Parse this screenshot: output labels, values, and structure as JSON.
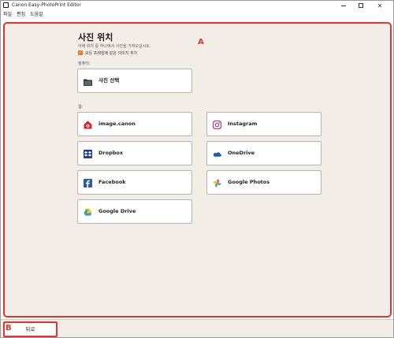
{
  "window": {
    "title": "Canon Easy-PhotoPrint Editor"
  },
  "menu": [
    "파일",
    "편집",
    "도움말"
  ],
  "callouts": {
    "a": "A",
    "b": "B"
  },
  "page": {
    "title": "사진 위치",
    "subtitle": "아래 위치 중 하나에서 사진을 가져오십시오.",
    "checkbox_label": "모든 프레임에 같은 이미지 추가",
    "checkbox_checked": true,
    "section_computer": "컴퓨터:",
    "section_web": "웹:"
  },
  "tiles": {
    "select_photo": {
      "label": "사진 선택",
      "icon": "folder-icon"
    },
    "image_canon": {
      "label": "image.canon",
      "icon": "image-canon-icon"
    },
    "instagram": {
      "label": "Instagram",
      "icon": "instagram-icon"
    },
    "dropbox": {
      "label": "Dropbox",
      "icon": "dropbox-icon"
    },
    "onedrive": {
      "label": "OneDrive",
      "icon": "onedrive-icon"
    },
    "facebook": {
      "label": "Facebook",
      "icon": "facebook-icon"
    },
    "google_photos": {
      "label": "Google Photos",
      "icon": "google-photos-icon"
    },
    "google_drive": {
      "label": "Google Drive",
      "icon": "google-drive-icon"
    }
  },
  "footer": {
    "back_label": "뒤로"
  },
  "colors": {
    "highlight": "#e4342e",
    "background": "#f2eee7",
    "checkbox": "#e07a1f"
  }
}
